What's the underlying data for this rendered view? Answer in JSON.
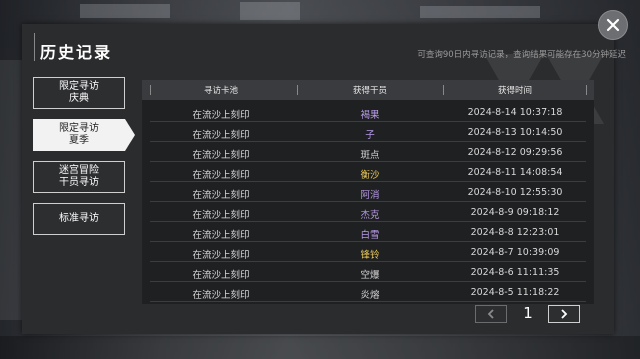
{
  "dialog": {
    "title": "历史记录",
    "subtitle": "可查询90日内寻访记录，查询结果可能存在30分钟延迟"
  },
  "tabs": [
    {
      "label_1": "限定寻访",
      "label_2": "庆典",
      "active": false
    },
    {
      "label_1": "限定寻访",
      "label_2": "夏季",
      "active": true
    },
    {
      "label_1": "迷宫冒险",
      "label_2": "干员寻访",
      "active": false
    },
    {
      "label_1": "标准寻访",
      "label_2": "",
      "active": false
    }
  ],
  "table": {
    "headers": [
      "寻访卡池",
      "获得干员",
      "获得时间"
    ],
    "rows": [
      {
        "pool": "在流沙上刻印",
        "operator": "褐果",
        "time": "2024-8-14 10:37:18",
        "color": "#b79ae6"
      },
      {
        "pool": "在流沙上刻印",
        "operator": "子",
        "time": "2024-8-13 10:14:50",
        "color": "#b79ae6"
      },
      {
        "pool": "在流沙上刻印",
        "operator": "斑点",
        "time": "2024-8-12 09:29:56",
        "color": "#d8d8d8"
      },
      {
        "pool": "在流沙上刻印",
        "operator": "衡沙",
        "time": "2024-8-11 14:08:54",
        "color": "#e8c85a"
      },
      {
        "pool": "在流沙上刻印",
        "operator": "阿消",
        "time": "2024-8-10 12:55:30",
        "color": "#b79ae6"
      },
      {
        "pool": "在流沙上刻印",
        "operator": "杰克",
        "time": "2024-8-9 09:18:12",
        "color": "#b79ae6"
      },
      {
        "pool": "在流沙上刻印",
        "operator": "白雪",
        "time": "2024-8-8 12:23:01",
        "color": "#b79ae6"
      },
      {
        "pool": "在流沙上刻印",
        "operator": "锋铃",
        "time": "2024-8-7 10:39:09",
        "color": "#e8c85a"
      },
      {
        "pool": "在流沙上刻印",
        "operator": "空爆",
        "time": "2024-8-6 11:11:35",
        "color": "#d8d8d8"
      },
      {
        "pool": "在流沙上刻印",
        "operator": "炎熔",
        "time": "2024-8-5 11:18:22",
        "color": "#d8d8d8"
      }
    ]
  },
  "pager": {
    "current_page": "1"
  },
  "icons": {
    "close": "close-icon",
    "prev": "chevron-left-icon",
    "next": "chevron-right-icon"
  }
}
